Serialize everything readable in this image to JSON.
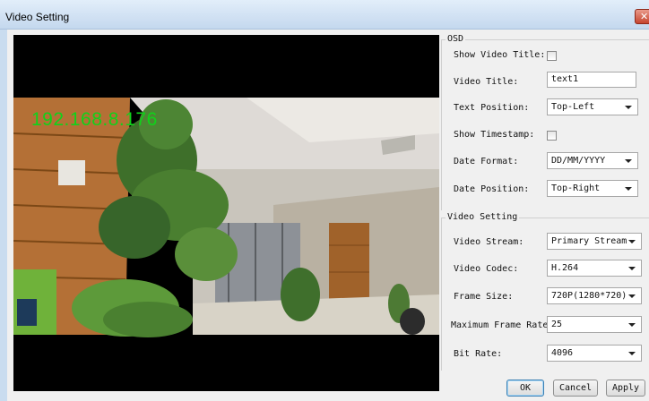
{
  "window": {
    "title": "Video Setting",
    "close_glyph": "✕"
  },
  "video": {
    "osd_overlay": "192.168.8.176"
  },
  "osd": {
    "group_label": "OSD",
    "show_title_label": "Show Video Title:",
    "show_title_checked": false,
    "title_label": "Video Title:",
    "title_value": "text1",
    "text_position_label": "Text Position:",
    "text_position_value": "Top-Left",
    "show_timestamp_label": "Show Timestamp:",
    "show_timestamp_checked": false,
    "date_format_label": "Date Format:",
    "date_format_value": "DD/MM/YYYY",
    "date_position_label": "Date Position:",
    "date_position_value": "Top-Right"
  },
  "video_setting": {
    "group_label": "Video Setting",
    "stream_label": "Video Stream:",
    "stream_value": "Primary Stream",
    "codec_label": "Video Codec:",
    "codec_value": "H.264",
    "frame_size_label": "Frame Size:",
    "frame_size_value": "720P(1280*720)",
    "max_frame_rate_label": "Maximum Frame Rate:",
    "max_frame_rate_value": "25",
    "bit_rate_label": "Bit Rate:",
    "bit_rate_value": "4096"
  },
  "buttons": {
    "ok": "OK",
    "cancel": "Cancel",
    "apply": "Apply"
  },
  "colors": {
    "osd_text": "#10d21a",
    "title_bar": "#d3e4f5",
    "close_button": "#c6452f"
  }
}
